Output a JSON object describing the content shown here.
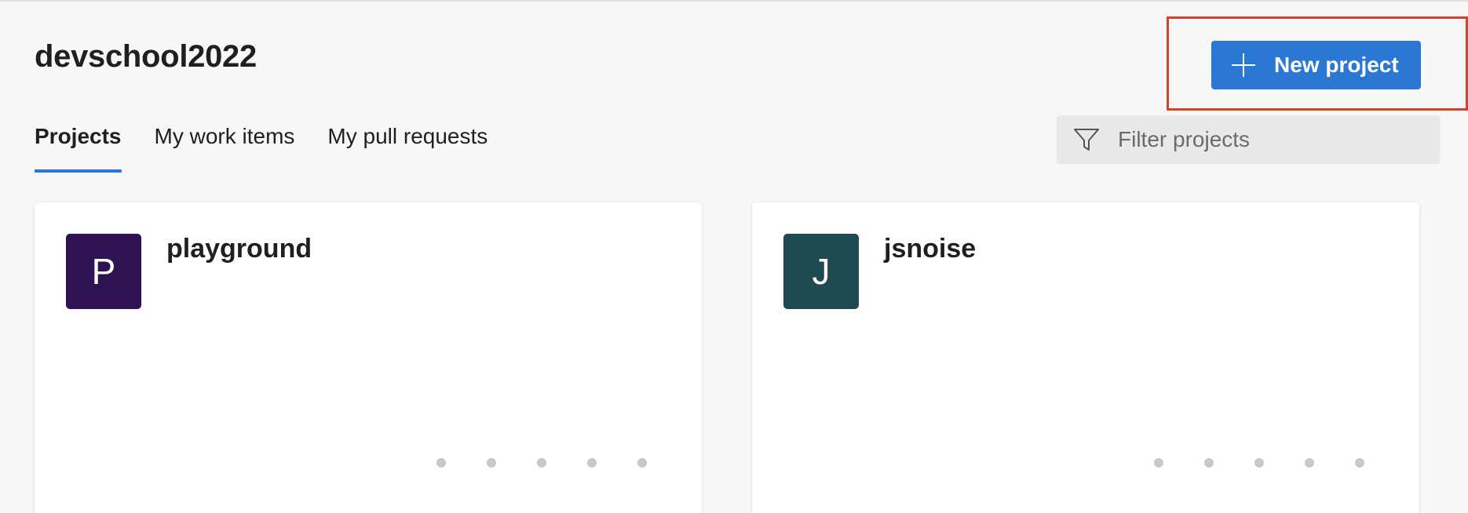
{
  "header": {
    "org_name": "devschool2022",
    "new_project_label": "New project",
    "accent_color": "#2b78d4",
    "highlight_color": "#d9422a"
  },
  "tabs": [
    {
      "label": "Projects",
      "active": true
    },
    {
      "label": "My work items",
      "active": false
    },
    {
      "label": "My pull requests",
      "active": false
    }
  ],
  "filter": {
    "placeholder": "Filter projects",
    "value": "",
    "icon": "filter-funnel-icon"
  },
  "projects": [
    {
      "initial": "P",
      "name": "playground",
      "avatar_color": "#2e1254"
    },
    {
      "initial": "J",
      "name": "jsnoise",
      "avatar_color": "#1e4a51"
    }
  ]
}
